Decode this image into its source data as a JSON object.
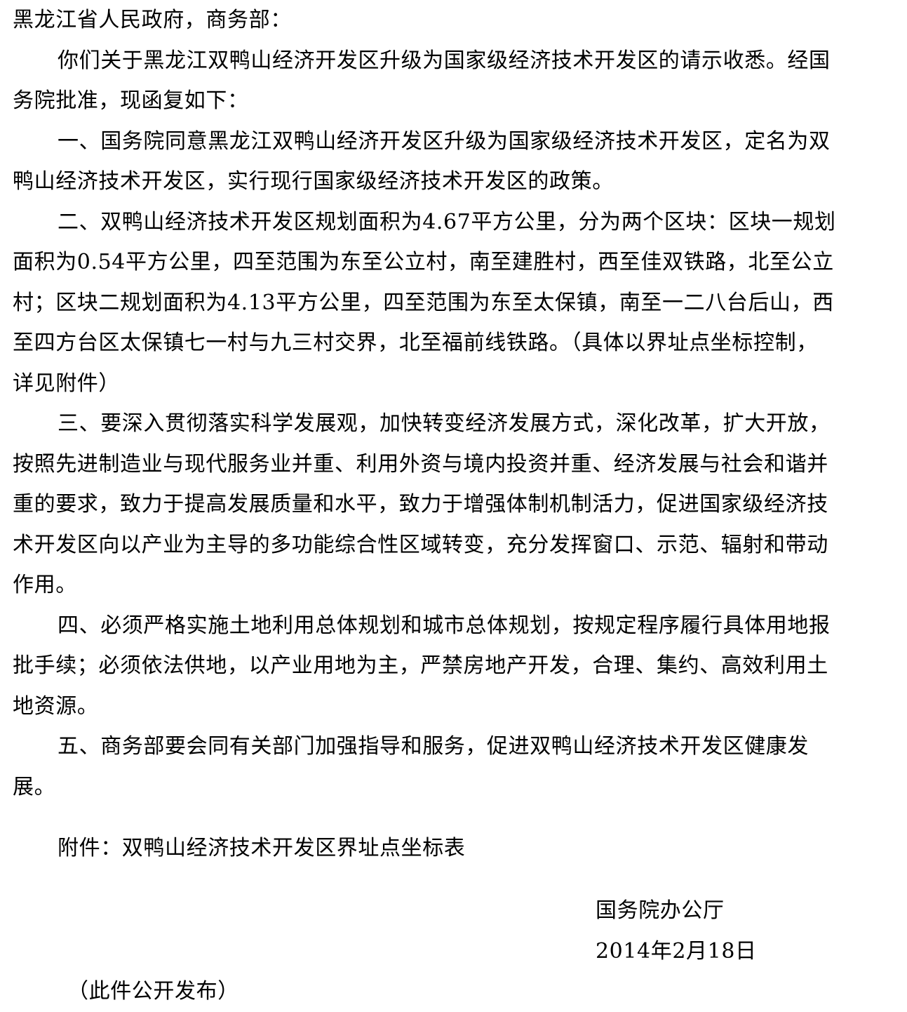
{
  "addressee": "黑龙江省人民政府，商务部：",
  "paragraphs": {
    "p0_l1": "你们关于黑龙江双鸭山经济开发区升级为国家级经济技术开发区的请示收悉。经国",
    "p0_l2": "务院批准，现函复如下：",
    "p1_l1": "一、国务院同意黑龙江双鸭山经济开发区升级为国家级经济技术开发区，定名为双",
    "p1_l2": "鸭山经济技术开发区，实行现行国家级经济技术开发区的政策。",
    "p2_l1": "二、双鸭山经济技术开发区规划面积为4.67平方公里，分为两个区块：区块一规划",
    "p2_l2": "面积为0.54平方公里，四至范围为东至公立村，南至建胜村，西至佳双铁路，北至公立",
    "p2_l3": "村；区块二规划面积为4.13平方公里，四至范围为东至太保镇，南至一二八台后山，西",
    "p2_l4": "至四方台区太保镇七一村与九三村交界，北至福前线铁路。（具体以界址点坐标控制，",
    "p2_l5": "详见附件）",
    "p3_l1": "三、要深入贯彻落实科学发展观，加快转变经济发展方式，深化改革，扩大开放，",
    "p3_l2": "按照先进制造业与现代服务业并重、利用外资与境内投资并重、经济发展与社会和谐并",
    "p3_l3": "重的要求，致力于提高发展质量和水平，致力于增强体制机制活力，促进国家级经济技",
    "p3_l4": "术开发区向以产业为主导的多功能综合性区域转变，充分发挥窗口、示范、辐射和带动",
    "p3_l5": "作用。",
    "p4_l1": "四、必须严格实施土地利用总体规划和城市总体规划，按规定程序履行具体用地报",
    "p4_l2": "批手续；必须依法供地，以产业用地为主，严禁房地产开发，合理、集约、高效利用土",
    "p4_l3": "地资源。",
    "p5_l1": "五、商务部要会同有关部门加强指导和服务，促进双鸭山经济技术开发区健康发",
    "p5_l2": "展。"
  },
  "attachment": "附件：双鸭山经济技术开发区界址点坐标表",
  "signature": {
    "org": "国务院办公厅",
    "date": "2014年2月18日"
  },
  "footnote": "（此件公开发布）"
}
